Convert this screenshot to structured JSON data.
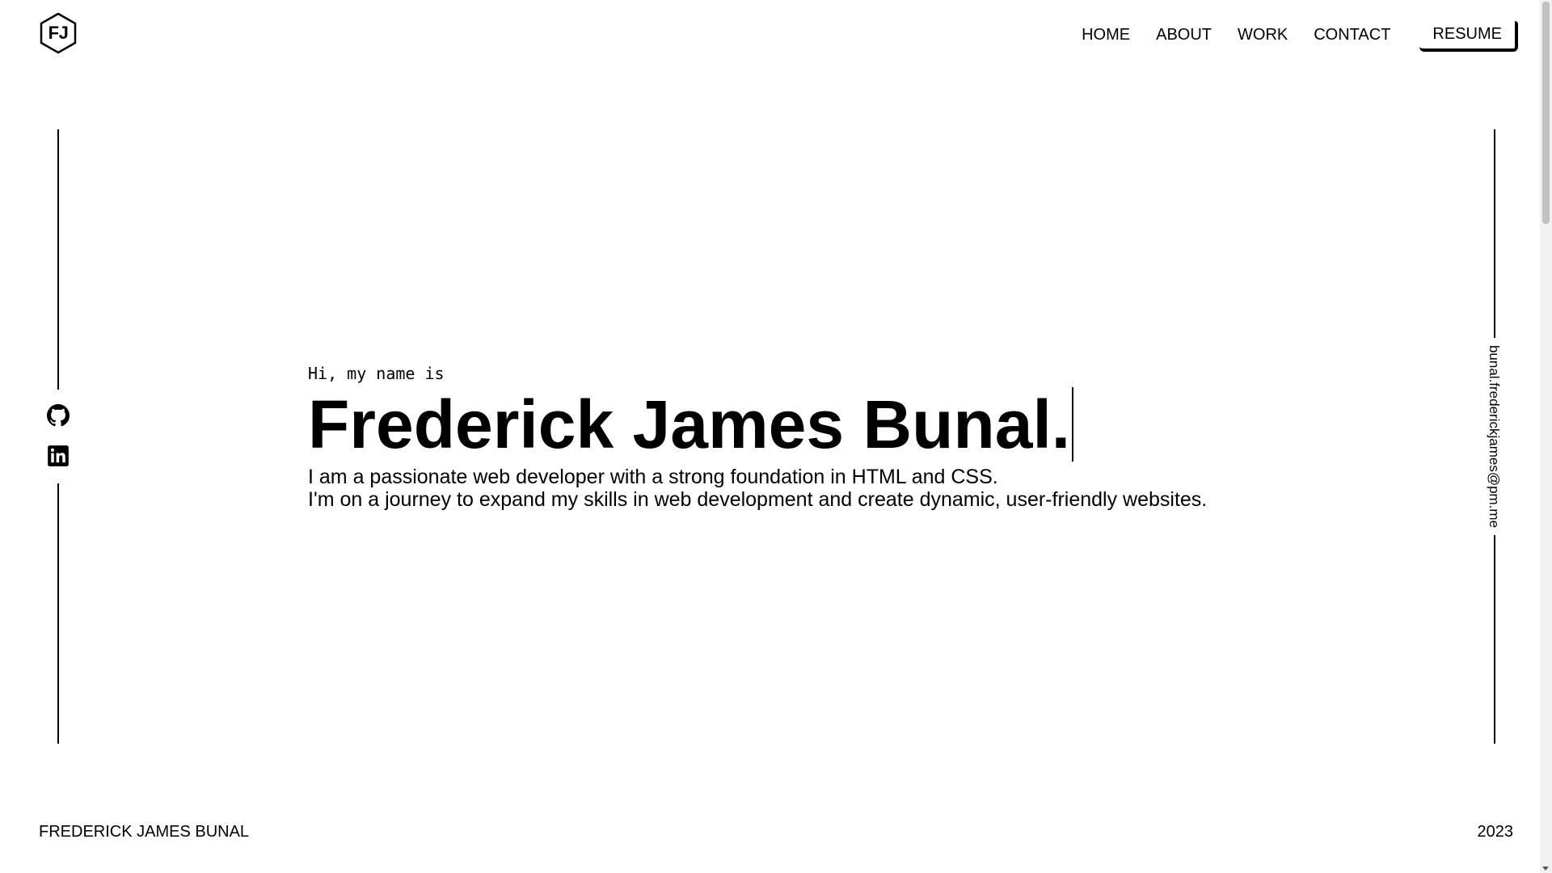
{
  "header": {
    "logo_text": "FJ",
    "nav": [
      {
        "label": "HOME"
      },
      {
        "label": "ABOUT"
      },
      {
        "label": "WORK"
      },
      {
        "label": "CONTACT"
      }
    ],
    "resume_label": "RESUME"
  },
  "social": {
    "icons": [
      "github-icon",
      "linkedin-icon"
    ]
  },
  "email": "bunal.frederickjames@pm.me",
  "hero": {
    "greeting": "Hi, my name is",
    "name": "Frederick James Bunal.",
    "bio_line1": "I am a passionate web developer with a strong foundation in HTML and CSS.",
    "bio_line2": "I'm on a journey to expand my skills in web development and create dynamic, user-friendly websites."
  },
  "footer": {
    "name": "FREDERICK JAMES BUNAL",
    "year": "2023"
  }
}
